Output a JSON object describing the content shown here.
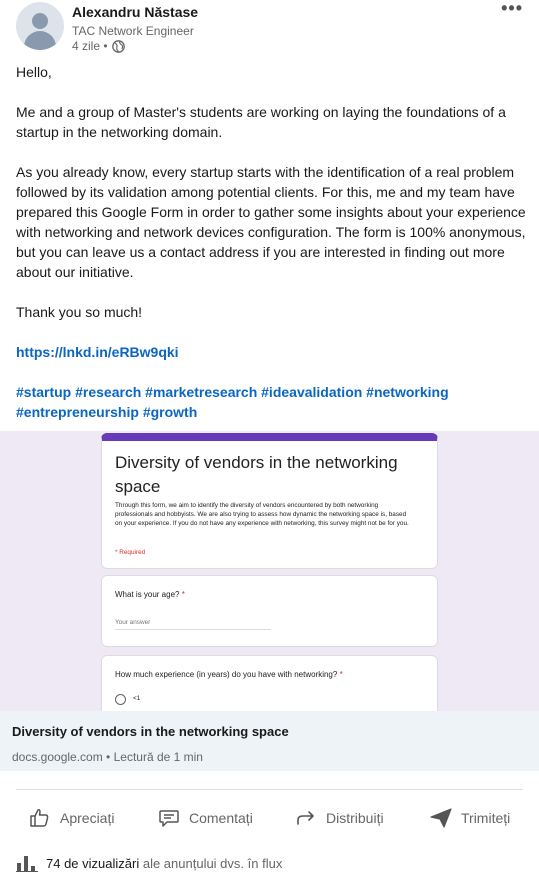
{
  "author": {
    "name": "Alexandru Năstase",
    "title": "TAC Network Engineer",
    "time": "4 zile •",
    "visibility_icon": "globe-icon",
    "menu_icon": "more-icon"
  },
  "post": {
    "greeting": "Hello,",
    "paragraph1": "Me and a group of Master's students are working on laying the foundations of a startup in the networking domain.",
    "paragraph2": "As you already know, every startup starts with the identification of a real problem followed by its validation among potential clients. For this, me and my team have prepared this Google Form in order to gather some insights about your experience with networking and network devices configuration. The form is 100% anonymous, but you can leave us a contact address if you are interested in finding out more about our initiative.",
    "thanks": "Thank you so much!",
    "link": "https://lnkd.in/eRBw9qki",
    "hashtags": "#startup #research #marketresearch #ideavalidation #networking #entrepreneurship #growth"
  },
  "preview": {
    "form_title": "Diversity of vendors in the networking space",
    "form_description": "Through this form, we aim to identify the diversity of vendors encountered by both networking professionals and hobbyists. We are also trying to assess how dynamic the networking space is, based on your experience. If you do not have any experience with networking, this survey might not be for you.",
    "required_note": "* Required",
    "q1_label": "What is your age?",
    "q1_placeholder": "Your answer",
    "q2_label": "How much experience (in years) do you have with networking?",
    "q2_option1": "<1",
    "required_star": "*",
    "card_title": "Diversity of vendors in the networking space",
    "card_subtitle": "docs.google.com • Lectură de 1 min",
    "accent_color": "#673ab7"
  },
  "actions": {
    "like": "Apreciați",
    "comment": "Comentați",
    "share": "Distribuiți",
    "send": "Trimiteți"
  },
  "views": {
    "count_label": "74 de vizualizări",
    "suffix": "ale anunțului dvs. în flux"
  }
}
